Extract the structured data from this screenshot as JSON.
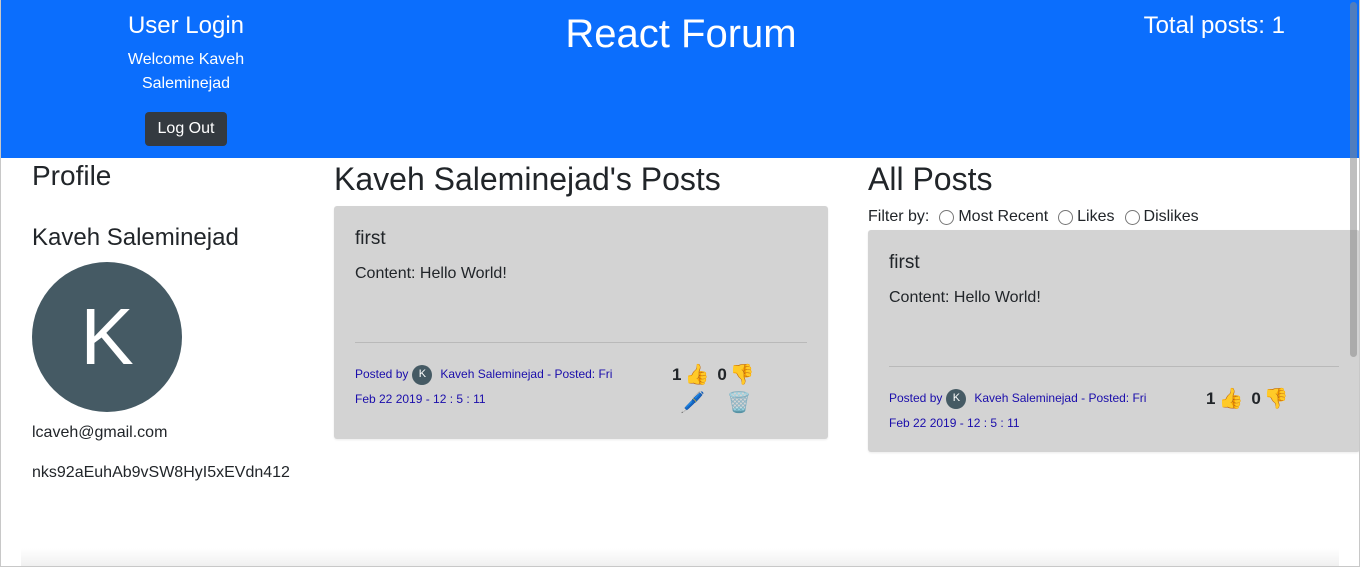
{
  "header": {
    "login_title": "User Login",
    "welcome": "Welcome Kaveh Saleminejad",
    "logout_label": "Log Out",
    "site_title": "React Forum",
    "total_posts": "Total posts: 1"
  },
  "profile": {
    "heading": "Profile",
    "name": "Kaveh Saleminejad",
    "avatar_initial": "K",
    "email": "lcaveh@gmail.com",
    "uid": "nks92aEuhAb9vSW8HyI5xEVdn412"
  },
  "user_posts": {
    "heading": "Kaveh Saleminejad's Posts",
    "post": {
      "title": "first",
      "content": "Content: Hello World!",
      "posted_by": "Posted by",
      "author_initial": "K",
      "author_posted": "Kaveh Saleminejad - Posted: Fri",
      "date": "Feb 22 2019 - 12 : 5 : 11",
      "likes": "1",
      "dislikes": "0",
      "like_icon": "👍",
      "dislike_icon": "👎",
      "edit_icon": "🖊️",
      "delete_icon": "🗑️"
    }
  },
  "all_posts": {
    "heading": "All Posts",
    "filter_label": "Filter by:",
    "filter_options": [
      "Most Recent",
      "Likes",
      "Dislikes"
    ],
    "post": {
      "title": "first",
      "content": "Content: Hello World!",
      "posted_by": "Posted by",
      "author_initial": "K",
      "author_posted": "Kaveh Saleminejad - Posted: Fri",
      "date": "Feb 22 2019 - 12 : 5 : 11",
      "likes": "1",
      "dislikes": "0",
      "like_icon": "👍",
      "dislike_icon": "👎"
    }
  },
  "colors": {
    "header_bg": "#0b6efd",
    "card_bg": "#d3d3d3",
    "button_bg": "#343a40",
    "avatar_bg": "#455a64",
    "meta_link": "#1a0dab"
  }
}
